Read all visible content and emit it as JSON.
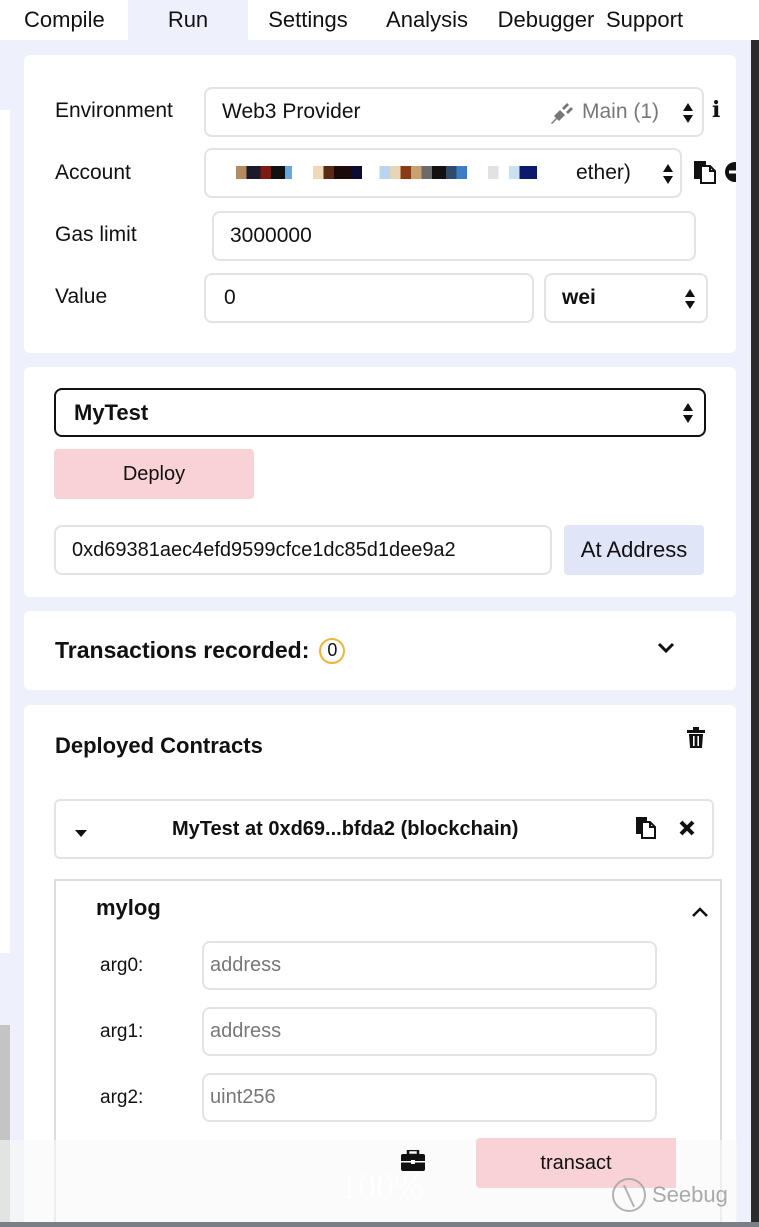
{
  "tabs": [
    {
      "label": "Compile",
      "active": false
    },
    {
      "label": "Run",
      "active": true
    },
    {
      "label": "Settings",
      "active": false
    },
    {
      "label": "Analysis",
      "active": false
    },
    {
      "label": "Debugger",
      "active": false
    },
    {
      "label": "Support",
      "active": false
    }
  ],
  "settings": {
    "environment_label": "Environment",
    "environment_value": "Web3 Provider",
    "network": "Main (1)",
    "account_label": "Account",
    "account_suffix": "ether)",
    "gas_limit_label": "Gas limit",
    "gas_limit_value": "3000000",
    "value_label": "Value",
    "value_value": "0",
    "value_unit": "wei"
  },
  "deploy": {
    "contract_selected": "MyTest",
    "deploy_label": "Deploy",
    "at_address_value": "0xd69381aec4efd9599cfce1dc85d1dee9a2",
    "at_address_label": "At Address"
  },
  "transactions": {
    "label": "Transactions recorded:",
    "count": "0"
  },
  "deployed": {
    "title": "Deployed Contracts",
    "instance_label": "MyTest at 0xd69...bfda2 (blockchain)",
    "function": {
      "name": "mylog",
      "args": [
        {
          "label": "arg0:",
          "placeholder": "address"
        },
        {
          "label": "arg1:",
          "placeholder": "address"
        },
        {
          "label": "arg2:",
          "placeholder": "uint256"
        }
      ],
      "transact_label": "transact"
    }
  },
  "overlay": {
    "ghost_text": "100%",
    "watermark": "Seebug"
  },
  "colors": {
    "panel_bg": "#eef0fb",
    "deploy_button": "#f8d2d4",
    "at_address_button": "#e1e5f8",
    "badge_ring": "#f0b43a"
  }
}
